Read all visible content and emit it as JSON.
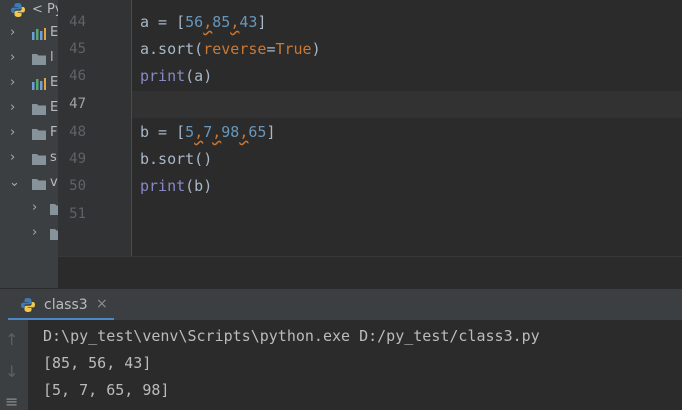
{
  "sidebar": {
    "title": "< Py",
    "rows": [
      {
        "chevron": "›",
        "icon": "chart-icon",
        "label": "E"
      },
      {
        "chevron": "›",
        "icon": "folder-icon",
        "label": "l"
      },
      {
        "chevron": "›",
        "icon": "chart-icon",
        "label": "E"
      },
      {
        "chevron": "›",
        "icon": "folder-icon",
        "label": "E"
      },
      {
        "chevron": "›",
        "icon": "folder-icon",
        "label": "F"
      },
      {
        "chevron": "›",
        "icon": "folder-icon",
        "label": "s"
      },
      {
        "chevron": "⌄",
        "icon": "folder-icon",
        "label": "v"
      },
      {
        "chevron": "›",
        "icon": "folder-icon",
        "label": ""
      },
      {
        "chevron": "›",
        "icon": "folder-icon",
        "label": ""
      }
    ]
  },
  "editor": {
    "line_numbers": [
      "44",
      "45",
      "46",
      "47",
      "48",
      "49",
      "50",
      "51"
    ],
    "current_line": "47",
    "lines": {
      "l44": {
        "a": "a = [",
        "n1": "56",
        "c1": ",",
        "n2": "85",
        "c2": ",",
        "n3": "43",
        "end": "]"
      },
      "l45": {
        "pre": "a.sort(",
        "kwarg": "reverse",
        "eq": "=",
        "val": "True",
        "end": ")"
      },
      "l46": {
        "fn": "print",
        "rest": "(a)"
      },
      "l48": {
        "a": "b = [",
        "n1": "5",
        "c1": ",",
        "n2": "7",
        "c2": ",",
        "n3": "98",
        "c3": ",",
        "n4": "65",
        "end": "]"
      },
      "l49": {
        "text": "b.sort()"
      },
      "l50": {
        "fn": "print",
        "rest": "(b)"
      }
    }
  },
  "run": {
    "tab_label": "class3",
    "close_glyph": "×",
    "up_arrow": "↑",
    "down_arrow": "↓",
    "wrap_glyph": "≡",
    "output": [
      "D:\\py_test\\venv\\Scripts\\python.exe D:/py_test/class3.py",
      "[85, 56, 43]",
      "[5, 7, 65, 98]"
    ]
  }
}
